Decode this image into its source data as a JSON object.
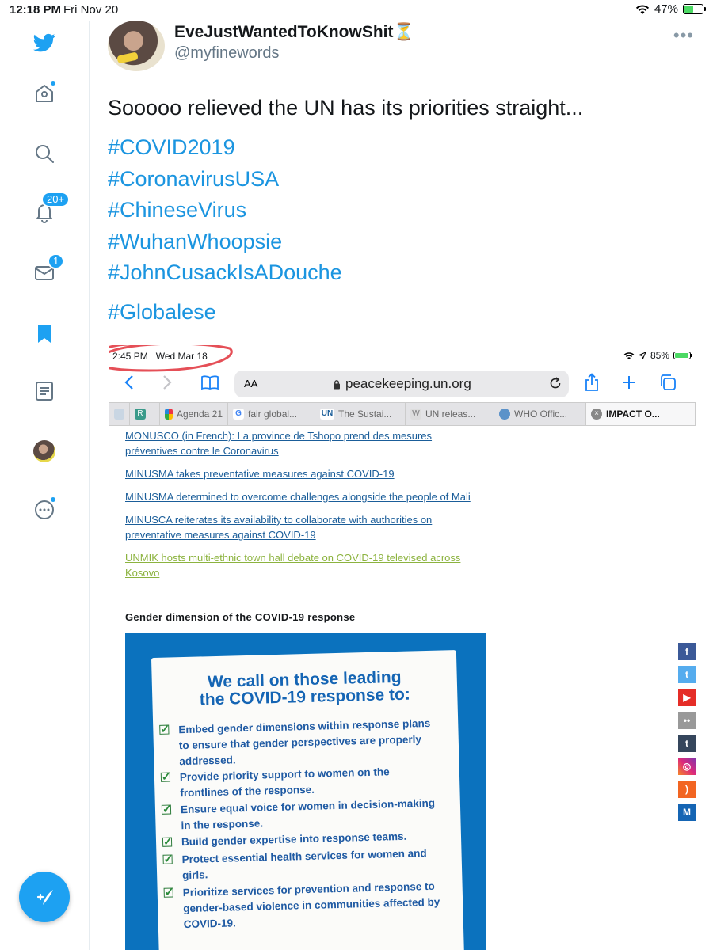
{
  "status_bar": {
    "time": "12:18 PM",
    "date": "Fri Nov 20",
    "battery": "47%",
    "battery_level": 0.47
  },
  "sidebar": {
    "notifications_badge": "20+",
    "messages_badge": "1",
    "icons": [
      "twitter-logo-icon",
      "home-icon",
      "search-icon",
      "notifications-icon",
      "messages-icon",
      "bookmarks-icon",
      "lists-icon",
      "profile-avatar",
      "more-icon",
      "compose-icon"
    ]
  },
  "tweet": {
    "author_name": "EveJustWantedToKnowShit",
    "author_emoji": "⏳",
    "handle": "@myfinewords",
    "text": "Sooooo relieved the UN has its priorities straight...",
    "hashtags": [
      "#COVID2019",
      "#CoronavirusUSA",
      "#ChineseVirus",
      "#WuhanWhoopsie",
      "#JohnCusackIsADouche",
      "#Globalese"
    ]
  },
  "screenshot": {
    "status": {
      "time": "2:45 PM",
      "date": "Wed Mar 18",
      "battery": "85%",
      "battery_level": 0.85
    },
    "address": {
      "aa": "AA",
      "url": "peacekeeping.un.org"
    },
    "tabs": [
      {
        "label": "",
        "fav": ""
      },
      {
        "label": "",
        "fav": "R"
      },
      {
        "label": "Agenda 21",
        "fav": ""
      },
      {
        "label": "fair global...",
        "fav": "G"
      },
      {
        "label": "The Sustai...",
        "fav": "UN"
      },
      {
        "label": "UN releas...",
        "fav": "W"
      },
      {
        "label": "WHO Offic...",
        "fav": ""
      },
      {
        "label": "IMPACT O...",
        "fav": ""
      }
    ],
    "links": [
      "MONUSCO (in French): La province de Tshopo prend des mesures",
      "préventives contre le Coronavirus",
      "MINUSMA takes preventative measures against COVID-19",
      "MINUSMA determined to overcome challenges alongside the people of Mali",
      "MINUSCA reiterates its availability to collaborate with authorities on",
      "preventative measures against COVID-19",
      "UNMIK hosts multi-ethnic town hall debate on COVID-19 televised across",
      "Kosovo"
    ],
    "section_heading": "Gender dimension of the COVID-19 response",
    "poster": {
      "title_line1": "We call on those leading",
      "title_line2": "the COVID-19 response to:",
      "items": [
        "Embed gender dimensions within response plans to ensure that gender perspectives are properly addressed.",
        "Provide priority support to women on the frontlines of the response.",
        "Ensure equal voice for women in decision-making in the response.",
        "Build gender expertise into response teams.",
        "Protect essential health services for women and girls.",
        "Prioritize services for prevention and response to gender-based violence in communities affected by COVID-19."
      ]
    },
    "social_icons": [
      "facebook-icon",
      "twitter-icon",
      "youtube-icon",
      "flickr-icon",
      "tumblr-icon",
      "instagram-icon",
      "rss-icon",
      "medium-icon"
    ]
  },
  "colors": {
    "twitter_blue": "#1da1f2",
    "hashtag_blue": "#1b95e0",
    "un_blue": "#0b72be",
    "link_blue": "#1a5d99",
    "visited_green": "#8cb33f",
    "annotation_red": "#e0303a"
  }
}
